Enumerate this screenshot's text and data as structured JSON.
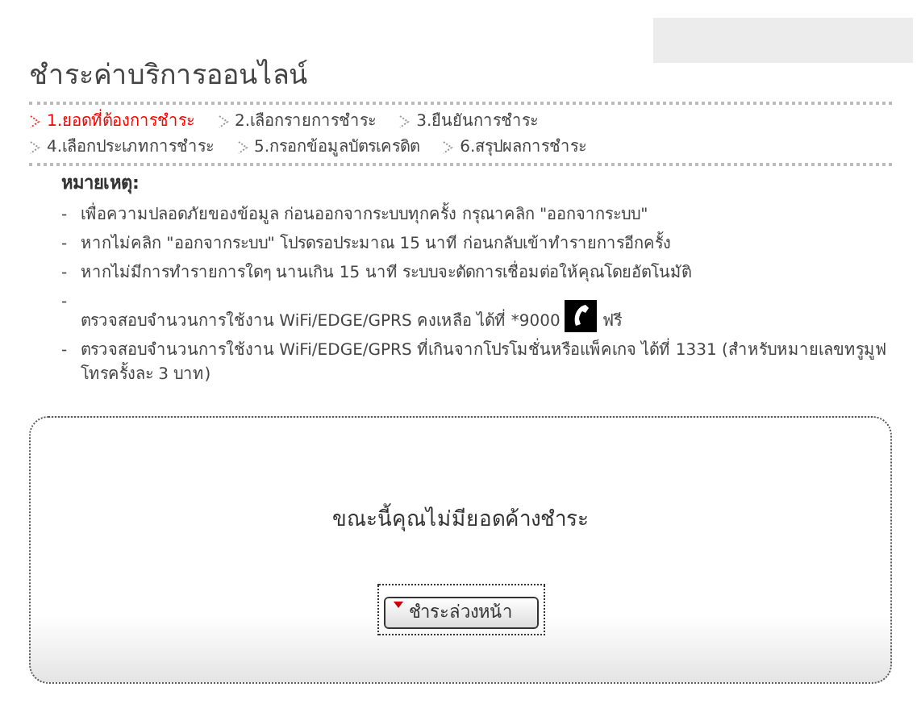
{
  "title": "ชำระค่าบริการออนไลน์",
  "steps": [
    [
      {
        "label": "1.ยอดที่ต้องการชำระ",
        "selected": true
      },
      {
        "label": "2.เลือกรายการชำระ",
        "selected": false
      },
      {
        "label": "3.ยืนยันการชำระ",
        "selected": false
      }
    ],
    [
      {
        "label": "4.เลือกประเภทการชำระ",
        "selected": false
      },
      {
        "label": "5.กรอกข้อมูลบัตรเครดิต",
        "selected": false
      },
      {
        "label": "6.สรุปผลการชำระ",
        "selected": false
      }
    ]
  ],
  "notes": {
    "heading": "หมายเหตุ:",
    "items": [
      {
        "bullet": "-",
        "text": "เพื่อความปลอดภัยของข้อมูล ก่อนออกจากระบบทุกครั้ง กรุณาคลิก \"ออกจากระบบ\"",
        "phone": false
      },
      {
        "bullet": "-",
        "text": "หากไม่คลิก \"ออกจากระบบ\" โปรดรอประมาณ 15 นาที ก่อนกลับเข้าทำรายการอีกครั้ง",
        "phone": false
      },
      {
        "bullet": "-",
        "text": "หากไม่มีการทำรายการใดๆ นานเกิน 15 นาที ระบบจะตัดการเชื่อมต่อให้คุณโดยอัตโนมัติ",
        "phone": false
      },
      {
        "bullet": "-",
        "text": "ตรวจสอบจำนวนการใช้งาน WiFi/EDGE/GPRS คงเหลือ ได้ที่ *9000",
        "phone": true,
        "after": "ฟรี"
      },
      {
        "bullet": "-",
        "text": "ตรวจสอบจำนวนการใช้งาน WiFi/EDGE/GPRS ที่เกินจากโปรโมชั่นหรือแพ็คเกจ ได้ที่ 1331 (สำหรับหมายเลขทรูมูฟโทรครั้งละ 3 บาท)",
        "phone": false
      }
    ]
  },
  "message": "ขณะนี้คุณไม่มียอดค้างชำระ",
  "button": "ชำระล่วงหน้า"
}
